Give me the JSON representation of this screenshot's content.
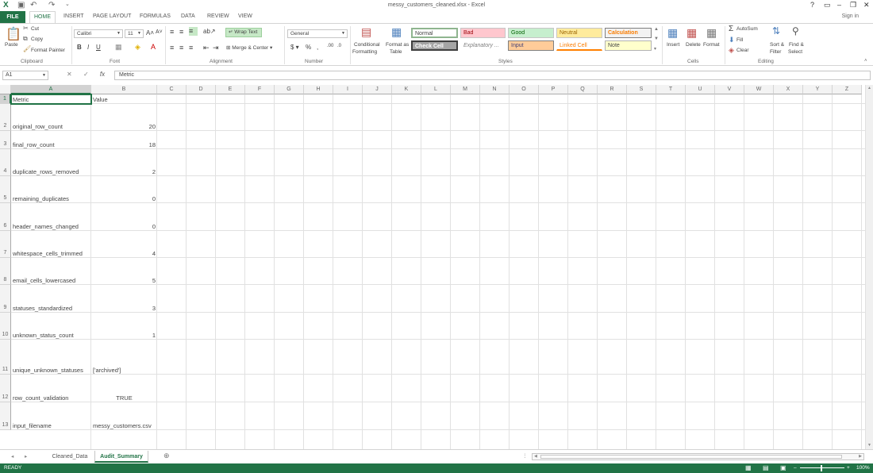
{
  "window": {
    "title": "messy_customers_cleaned.xlsx - Excel"
  },
  "ribbon_tabs": {
    "file": "FILE",
    "home": "HOME",
    "insert": "INSERT",
    "page_layout": "PAGE LAYOUT",
    "formulas": "FORMULAS",
    "data": "DATA",
    "review": "REVIEW",
    "view": "VIEW"
  },
  "account": {
    "sign_in": "Sign in"
  },
  "clipboard": {
    "paste": "Paste",
    "cut": "Cut",
    "copy": "Copy",
    "format_painter": "Format Painter",
    "label": "Clipboard"
  },
  "font": {
    "name": "Calibri",
    "size": "11",
    "label": "Font"
  },
  "alignment": {
    "wrap_text": "Wrap Text",
    "merge_center": "Merge & Center",
    "label": "Alignment"
  },
  "number": {
    "format": "General",
    "label": "Number"
  },
  "styles": {
    "conditional": "Conditional",
    "formatting": "Formatting",
    "format_as": "Format as",
    "table": "Table",
    "label": "Styles",
    "cells": {
      "normal": "Normal",
      "bad": "Bad",
      "good": "Good",
      "neutral": "Neutral",
      "calculation": "Calculation",
      "check_cell": "Check Cell",
      "explanatory": "Explanatory ...",
      "input": "Input",
      "linked_cell": "Linked Cell",
      "note": "Note"
    }
  },
  "cells_group": {
    "insert": "Insert",
    "delete": "Delete",
    "format": "Format",
    "label": "Cells"
  },
  "editing": {
    "autosum": "AutoSum",
    "fill": "Fill",
    "clear": "Clear",
    "sort_filter": "Sort &",
    "filter": "Filter",
    "find_select": "Find &",
    "select": "Select",
    "label": "Editing"
  },
  "formula_bar": {
    "name_box": "A1",
    "content": "Metric"
  },
  "columns": [
    "A",
    "B",
    "C",
    "D",
    "E",
    "F",
    "G",
    "H",
    "I",
    "J",
    "K",
    "L",
    "M",
    "N",
    "O",
    "P",
    "Q",
    "R",
    "S",
    "T",
    "U",
    "V",
    "W",
    "X",
    "Y",
    "Z"
  ],
  "rows": [
    {
      "num": "1",
      "metric": "Metric",
      "value": "Value"
    },
    {
      "num": "2",
      "metric": "original_row_count",
      "value": "20"
    },
    {
      "num": "3",
      "metric": "final_row_count",
      "value": "18"
    },
    {
      "num": "4",
      "metric": "duplicate_rows_removed",
      "value": "2"
    },
    {
      "num": "5",
      "metric": "remaining_duplicates",
      "value": "0"
    },
    {
      "num": "6",
      "metric": "header_names_changed",
      "value": "0"
    },
    {
      "num": "7",
      "metric": "whitespace_cells_trimmed",
      "value": "4"
    },
    {
      "num": "8",
      "metric": "email_cells_lowercased",
      "value": "5"
    },
    {
      "num": "9",
      "metric": "statuses_standardized",
      "value": "3"
    },
    {
      "num": "10",
      "metric": "unknown_status_count",
      "value": "1"
    },
    {
      "num": "11",
      "metric": "unique_unknown_statuses",
      "value": "['archived']"
    },
    {
      "num": "12",
      "metric": "row_count_validation",
      "value": "TRUE"
    },
    {
      "num": "13",
      "metric": "input_filename",
      "value": "messy_customers.csv"
    }
  ],
  "sheets": {
    "tab1": "Cleaned_Data",
    "tab2": "Audit_Summary"
  },
  "status": {
    "ready": "READY",
    "zoom": "100%"
  }
}
